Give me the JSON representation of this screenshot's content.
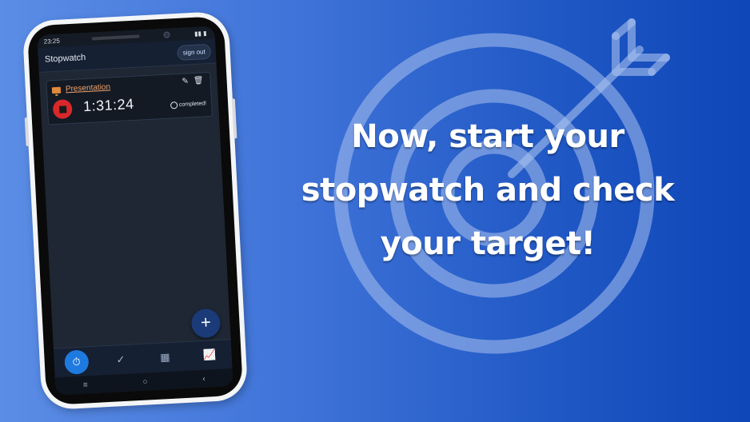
{
  "headline": {
    "line1": "Now, start your",
    "line2": "stopwatch and check",
    "line3": "your target!"
  },
  "phone": {
    "status_time": "23:25",
    "app_title": "Stopwatch",
    "sign_out_label": "sign out",
    "task": {
      "name": "Presentation",
      "timer": "1:31:24",
      "status": "completed!"
    },
    "fab_label": "+",
    "nav": [
      {
        "icon": "stopwatch-icon",
        "active": true
      },
      {
        "icon": "check-circle-icon",
        "active": false
      },
      {
        "icon": "table-icon",
        "active": false
      },
      {
        "icon": "line-chart-icon",
        "active": false
      }
    ]
  },
  "colors": {
    "background_left": "#5b8de6",
    "background_right": "#0f46b8",
    "stop_button": "#d9282b",
    "task_name": "#f0a26b",
    "active_nav": "#1f7ae0"
  }
}
